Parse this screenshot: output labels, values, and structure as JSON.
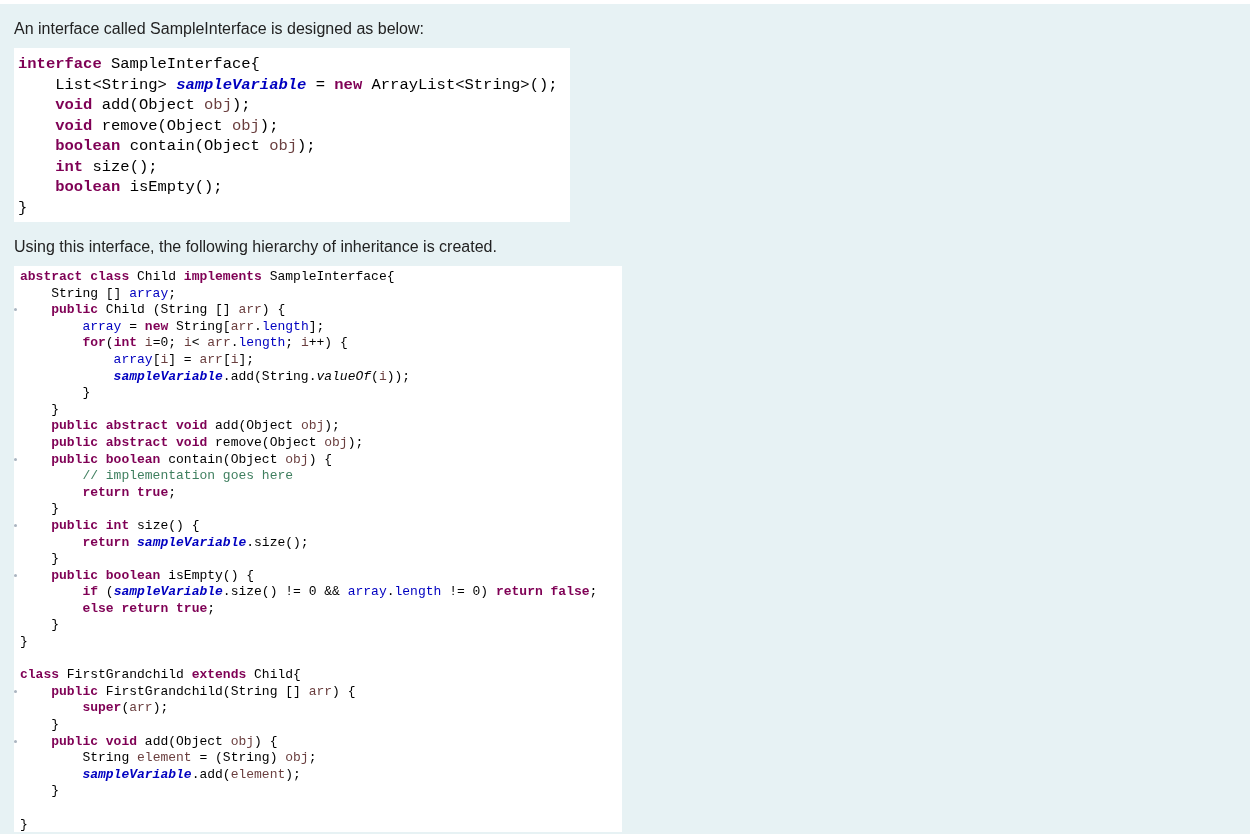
{
  "blocks": [
    {
      "kind": "paragraph",
      "text": "An interface called SampleInterface is designed as below:"
    },
    {
      "kind": "code",
      "lines": [
        {
          "kind": "code",
          "tokens": [
            {
              "kind": "keyword",
              "text": "interface "
            },
            {
              "kind": "plain",
              "text": "SampleInterface{"
            }
          ]
        },
        {
          "kind": "code",
          "tokens": [
            {
              "kind": "plain",
              "text": "    List<String> "
            },
            {
              "kind": "static",
              "text": "sampleVariable"
            },
            {
              "kind": "plain",
              "text": " = "
            },
            {
              "kind": "keyword",
              "text": "new "
            },
            {
              "kind": "plain",
              "text": "ArrayList<String>();"
            }
          ]
        },
        {
          "kind": "code",
          "tokens": [
            {
              "kind": "keyword",
              "text": "    void "
            },
            {
              "kind": "plain",
              "text": "add(Object "
            },
            {
              "kind": "param",
              "text": "obj"
            },
            {
              "kind": "plain",
              "text": ");"
            }
          ]
        },
        {
          "kind": "code",
          "tokens": [
            {
              "kind": "keyword",
              "text": "    void "
            },
            {
              "kind": "plain",
              "text": "remove(Object "
            },
            {
              "kind": "param",
              "text": "obj"
            },
            {
              "kind": "plain",
              "text": ");"
            }
          ]
        },
        {
          "kind": "code",
          "tokens": [
            {
              "kind": "keyword",
              "text": "    boolean "
            },
            {
              "kind": "plain",
              "text": "contain(Object "
            },
            {
              "kind": "param",
              "text": "obj"
            },
            {
              "kind": "plain",
              "text": ");"
            }
          ]
        },
        {
          "kind": "code",
          "tokens": [
            {
              "kind": "keyword",
              "text": "    int "
            },
            {
              "kind": "plain",
              "text": "size();"
            }
          ]
        },
        {
          "kind": "code",
          "tokens": [
            {
              "kind": "keyword",
              "text": "    boolean "
            },
            {
              "kind": "plain",
              "text": "isEmpty();"
            }
          ]
        },
        {
          "kind": "code",
          "tokens": [
            {
              "kind": "plain",
              "text": "}"
            }
          ]
        }
      ]
    },
    {
      "kind": "paragraph",
      "text": "Using this interface, the following hierarchy of inheritance is created."
    },
    {
      "kind": "code_small",
      "lines": [
        {
          "kind": "code",
          "fold": false,
          "tokens": [
            {
              "kind": "keyword",
              "text": "abstract class "
            },
            {
              "kind": "plain",
              "text": "Child "
            },
            {
              "kind": "keyword",
              "text": "implements "
            },
            {
              "kind": "plain",
              "text": "SampleInterface{"
            }
          ]
        },
        {
          "kind": "code",
          "fold": false,
          "tokens": [
            {
              "kind": "plain",
              "text": "    String [] "
            },
            {
              "kind": "field",
              "text": "array"
            },
            {
              "kind": "plain",
              "text": ";"
            }
          ]
        },
        {
          "kind": "code",
          "fold": true,
          "tokens": [
            {
              "kind": "keyword",
              "text": "    public "
            },
            {
              "kind": "plain",
              "text": "Child (String [] "
            },
            {
              "kind": "param",
              "text": "arr"
            },
            {
              "kind": "plain",
              "text": ") {"
            }
          ]
        },
        {
          "kind": "code",
          "fold": false,
          "tokens": [
            {
              "kind": "field",
              "text": "        array"
            },
            {
              "kind": "plain",
              "text": " = "
            },
            {
              "kind": "keyword",
              "text": "new "
            },
            {
              "kind": "plain",
              "text": "String["
            },
            {
              "kind": "param",
              "text": "arr"
            },
            {
              "kind": "plain",
              "text": "."
            },
            {
              "kind": "field",
              "text": "length"
            },
            {
              "kind": "plain",
              "text": "];"
            }
          ]
        },
        {
          "kind": "code",
          "fold": false,
          "tokens": [
            {
              "kind": "keyword",
              "text": "        for"
            },
            {
              "kind": "plain",
              "text": "("
            },
            {
              "kind": "keyword",
              "text": "int "
            },
            {
              "kind": "param",
              "text": "i"
            },
            {
              "kind": "plain",
              "text": "=0; "
            },
            {
              "kind": "param",
              "text": "i"
            },
            {
              "kind": "plain",
              "text": "< "
            },
            {
              "kind": "param",
              "text": "arr"
            },
            {
              "kind": "plain",
              "text": "."
            },
            {
              "kind": "field",
              "text": "length"
            },
            {
              "kind": "plain",
              "text": "; "
            },
            {
              "kind": "param",
              "text": "i"
            },
            {
              "kind": "plain",
              "text": "++) {"
            }
          ]
        },
        {
          "kind": "code",
          "fold": false,
          "tokens": [
            {
              "kind": "field",
              "text": "            array"
            },
            {
              "kind": "plain",
              "text": "["
            },
            {
              "kind": "param",
              "text": "i"
            },
            {
              "kind": "plain",
              "text": "] = "
            },
            {
              "kind": "param",
              "text": "arr"
            },
            {
              "kind": "plain",
              "text": "["
            },
            {
              "kind": "param",
              "text": "i"
            },
            {
              "kind": "plain",
              "text": "];"
            }
          ]
        },
        {
          "kind": "code",
          "fold": false,
          "tokens": [
            {
              "kind": "static",
              "text": "            sampleVariable"
            },
            {
              "kind": "plain",
              "text": ".add(String."
            },
            {
              "kind": "italic",
              "text": "valueOf"
            },
            {
              "kind": "plain",
              "text": "("
            },
            {
              "kind": "param",
              "text": "i"
            },
            {
              "kind": "plain",
              "text": "));"
            }
          ]
        },
        {
          "kind": "code",
          "fold": false,
          "tokens": [
            {
              "kind": "plain",
              "text": "        }"
            }
          ]
        },
        {
          "kind": "code",
          "fold": false,
          "tokens": [
            {
              "kind": "plain",
              "text": "    }"
            }
          ]
        },
        {
          "kind": "code",
          "fold": false,
          "tokens": [
            {
              "kind": "keyword",
              "text": "    public abstract void "
            },
            {
              "kind": "plain",
              "text": "add(Object "
            },
            {
              "kind": "param",
              "text": "obj"
            },
            {
              "kind": "plain",
              "text": ");"
            }
          ]
        },
        {
          "kind": "code",
          "fold": false,
          "tokens": [
            {
              "kind": "keyword",
              "text": "    public abstract void "
            },
            {
              "kind": "plain",
              "text": "remove(Object "
            },
            {
              "kind": "param",
              "text": "obj"
            },
            {
              "kind": "plain",
              "text": ");"
            }
          ]
        },
        {
          "kind": "code",
          "fold": true,
          "tokens": [
            {
              "kind": "keyword",
              "text": "    public boolean "
            },
            {
              "kind": "plain",
              "text": "contain(Object "
            },
            {
              "kind": "param",
              "text": "obj"
            },
            {
              "kind": "plain",
              "text": ") {"
            }
          ]
        },
        {
          "kind": "code",
          "fold": false,
          "tokens": [
            {
              "kind": "comment",
              "text": "        // implementation goes here"
            }
          ]
        },
        {
          "kind": "code",
          "fold": false,
          "tokens": [
            {
              "kind": "keyword",
              "text": "        return true"
            },
            {
              "kind": "plain",
              "text": ";"
            }
          ]
        },
        {
          "kind": "code",
          "fold": false,
          "tokens": [
            {
              "kind": "plain",
              "text": "    }"
            }
          ]
        },
        {
          "kind": "code",
          "fold": true,
          "tokens": [
            {
              "kind": "keyword",
              "text": "    public int "
            },
            {
              "kind": "plain",
              "text": "size() {"
            }
          ]
        },
        {
          "kind": "code",
          "fold": false,
          "tokens": [
            {
              "kind": "keyword",
              "text": "        return "
            },
            {
              "kind": "static",
              "text": "sampleVariable"
            },
            {
              "kind": "plain",
              "text": ".size();"
            }
          ]
        },
        {
          "kind": "code",
          "fold": false,
          "tokens": [
            {
              "kind": "plain",
              "text": "    }"
            }
          ]
        },
        {
          "kind": "code",
          "fold": true,
          "tokens": [
            {
              "kind": "keyword",
              "text": "    public boolean "
            },
            {
              "kind": "plain",
              "text": "isEmpty() {"
            }
          ]
        },
        {
          "kind": "code",
          "fold": false,
          "tokens": [
            {
              "kind": "keyword",
              "text": "        if "
            },
            {
              "kind": "plain",
              "text": "("
            },
            {
              "kind": "static",
              "text": "sampleVariable"
            },
            {
              "kind": "plain",
              "text": ".size() != 0 && "
            },
            {
              "kind": "field",
              "text": "array"
            },
            {
              "kind": "plain",
              "text": "."
            },
            {
              "kind": "field",
              "text": "length"
            },
            {
              "kind": "plain",
              "text": " != 0) "
            },
            {
              "kind": "keyword",
              "text": "return false"
            },
            {
              "kind": "plain",
              "text": ";"
            }
          ]
        },
        {
          "kind": "code",
          "fold": false,
          "tokens": [
            {
              "kind": "keyword",
              "text": "        else return true"
            },
            {
              "kind": "plain",
              "text": ";"
            }
          ]
        },
        {
          "kind": "code",
          "fold": false,
          "tokens": [
            {
              "kind": "plain",
              "text": "    }"
            }
          ]
        },
        {
          "kind": "code",
          "fold": false,
          "tokens": [
            {
              "kind": "plain",
              "text": "}"
            }
          ]
        },
        {
          "kind": "blank"
        },
        {
          "kind": "code",
          "fold": false,
          "tokens": [
            {
              "kind": "keyword",
              "text": "class "
            },
            {
              "kind": "plain",
              "text": "FirstGrandchild "
            },
            {
              "kind": "keyword",
              "text": "extends "
            },
            {
              "kind": "plain",
              "text": "Child{"
            }
          ]
        },
        {
          "kind": "code",
          "fold": true,
          "tokens": [
            {
              "kind": "keyword",
              "text": "    public "
            },
            {
              "kind": "plain",
              "text": "FirstGrandchild(String [] "
            },
            {
              "kind": "param",
              "text": "arr"
            },
            {
              "kind": "plain",
              "text": ") {"
            }
          ]
        },
        {
          "kind": "code",
          "fold": false,
          "tokens": [
            {
              "kind": "keyword",
              "text": "        super"
            },
            {
              "kind": "plain",
              "text": "("
            },
            {
              "kind": "param",
              "text": "arr"
            },
            {
              "kind": "plain",
              "text": ");"
            }
          ]
        },
        {
          "kind": "code",
          "fold": false,
          "tokens": [
            {
              "kind": "plain",
              "text": "    }"
            }
          ]
        },
        {
          "kind": "code",
          "fold": true,
          "tokens": [
            {
              "kind": "keyword",
              "text": "    public void "
            },
            {
              "kind": "plain",
              "text": "add(Object "
            },
            {
              "kind": "param",
              "text": "obj"
            },
            {
              "kind": "plain",
              "text": ") {"
            }
          ]
        },
        {
          "kind": "code",
          "fold": false,
          "tokens": [
            {
              "kind": "plain",
              "text": "        String "
            },
            {
              "kind": "param",
              "text": "element"
            },
            {
              "kind": "plain",
              "text": " = (String) "
            },
            {
              "kind": "param",
              "text": "obj"
            },
            {
              "kind": "plain",
              "text": ";"
            }
          ]
        },
        {
          "kind": "code",
          "fold": false,
          "tokens": [
            {
              "kind": "static",
              "text": "        sampleVariable"
            },
            {
              "kind": "plain",
              "text": ".add("
            },
            {
              "kind": "param",
              "text": "element"
            },
            {
              "kind": "plain",
              "text": ");"
            }
          ]
        },
        {
          "kind": "code",
          "fold": false,
          "tokens": [
            {
              "kind": "plain",
              "text": "    }"
            }
          ]
        },
        {
          "kind": "blank"
        },
        {
          "kind": "code",
          "fold": false,
          "tokens": [
            {
              "kind": "plain",
              "text": "}"
            }
          ]
        }
      ]
    }
  ]
}
